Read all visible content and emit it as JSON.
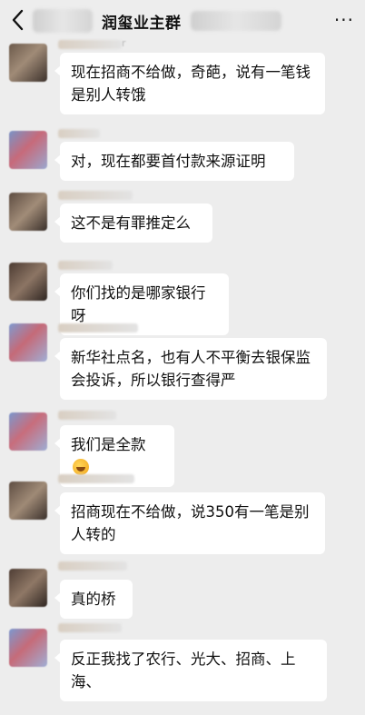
{
  "header": {
    "title": "润玺业主群",
    "more_label": "···",
    "back_icon": "chevron-left-icon",
    "name_fragment": "r"
  },
  "messages": [
    {
      "id": 1,
      "text": "现在招商不给做，奇葩，说有一笔钱是别人转饿"
    },
    {
      "id": 2,
      "text": "对，现在都要首付款来源证明"
    },
    {
      "id": 3,
      "text": "这不是有罪推定么"
    },
    {
      "id": 4,
      "text": "你们找的是哪家银行呀"
    },
    {
      "id": 5,
      "text": "新华社点名，也有人不平衡去银保监会投诉，所以银行查得严"
    },
    {
      "id": 6,
      "text": "我们是全款",
      "emoji": "laughing-crying-icon"
    },
    {
      "id": 7,
      "text": "招商现在不给做，说350有一笔是别人转的"
    },
    {
      "id": 8,
      "text": "真的桥"
    },
    {
      "id": 9,
      "text": "反正我找了农行、光大、招商、上海、"
    }
  ]
}
